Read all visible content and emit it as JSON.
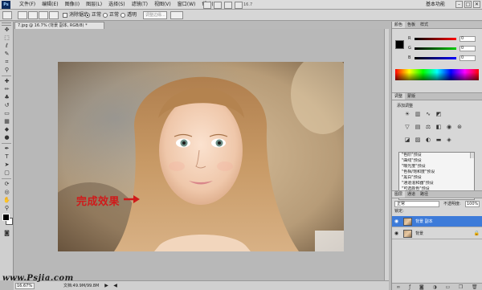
{
  "menubar": {
    "logo": "Ps",
    "menus": [
      "文件(F)",
      "编辑(E)",
      "图像(I)",
      "图层(L)",
      "选择(S)",
      "滤镜(T)",
      "视图(V)",
      "窗口(W)",
      "帮助(H)"
    ],
    "zoom": "16.7",
    "workspace": "基本功能",
    "minimize": "–",
    "restore": "□",
    "close": "✕"
  },
  "options": {
    "feather_label": "羽化:",
    "feather_value": "0 px",
    "antialias_label": "消除锯齿",
    "mode_normal": "正常",
    "mode_label": "样式:",
    "style_normal": "正常",
    "transparent_label": "透明",
    "refine_label": "调整边缘..."
  },
  "document": {
    "tab_title": "7.jpg @ 16.7% (背景 副本, RGB/8) *"
  },
  "canvas": {
    "caption": "完成效果",
    "arrow": "→"
  },
  "statusbar": {
    "zoom": "16.67%",
    "docinfo": "文档:49.9M/99.8M",
    "prev": "◀",
    "next": "▶"
  },
  "watermark": "www.Psjia.com",
  "panels": {
    "color_tabs": [
      "颜色",
      "色板",
      "样式"
    ],
    "sliders": [
      {
        "label": "R",
        "value": "0"
      },
      {
        "label": "G",
        "value": "0"
      },
      {
        "label": "B",
        "value": "0"
      }
    ],
    "adj_tabs": [
      "调整",
      "蒙版"
    ],
    "adj_title": "添加调整",
    "presets": [
      "\"色阶\"预设",
      "\"曲线\"预设",
      "\"曝光度\"预设",
      "\"色相/饱和度\"预设",
      "\"黑白\"预设",
      "\"通道混和器\"预设",
      "\"可选颜色\"预设"
    ],
    "layer_tabs": [
      "图层",
      "通道",
      "路径"
    ],
    "blend_mode": "正常",
    "opacity_label": "不透明度:",
    "opacity_value": "100%",
    "fill_label": "锁定:",
    "layers": [
      {
        "name": "背景 副本",
        "selected": true
      },
      {
        "name": "背景",
        "selected": false
      }
    ]
  },
  "colors": {
    "accent": "#3d7bd9",
    "caption_red": "#cf1b1b",
    "canvas_bg": "#b8b8b8"
  }
}
